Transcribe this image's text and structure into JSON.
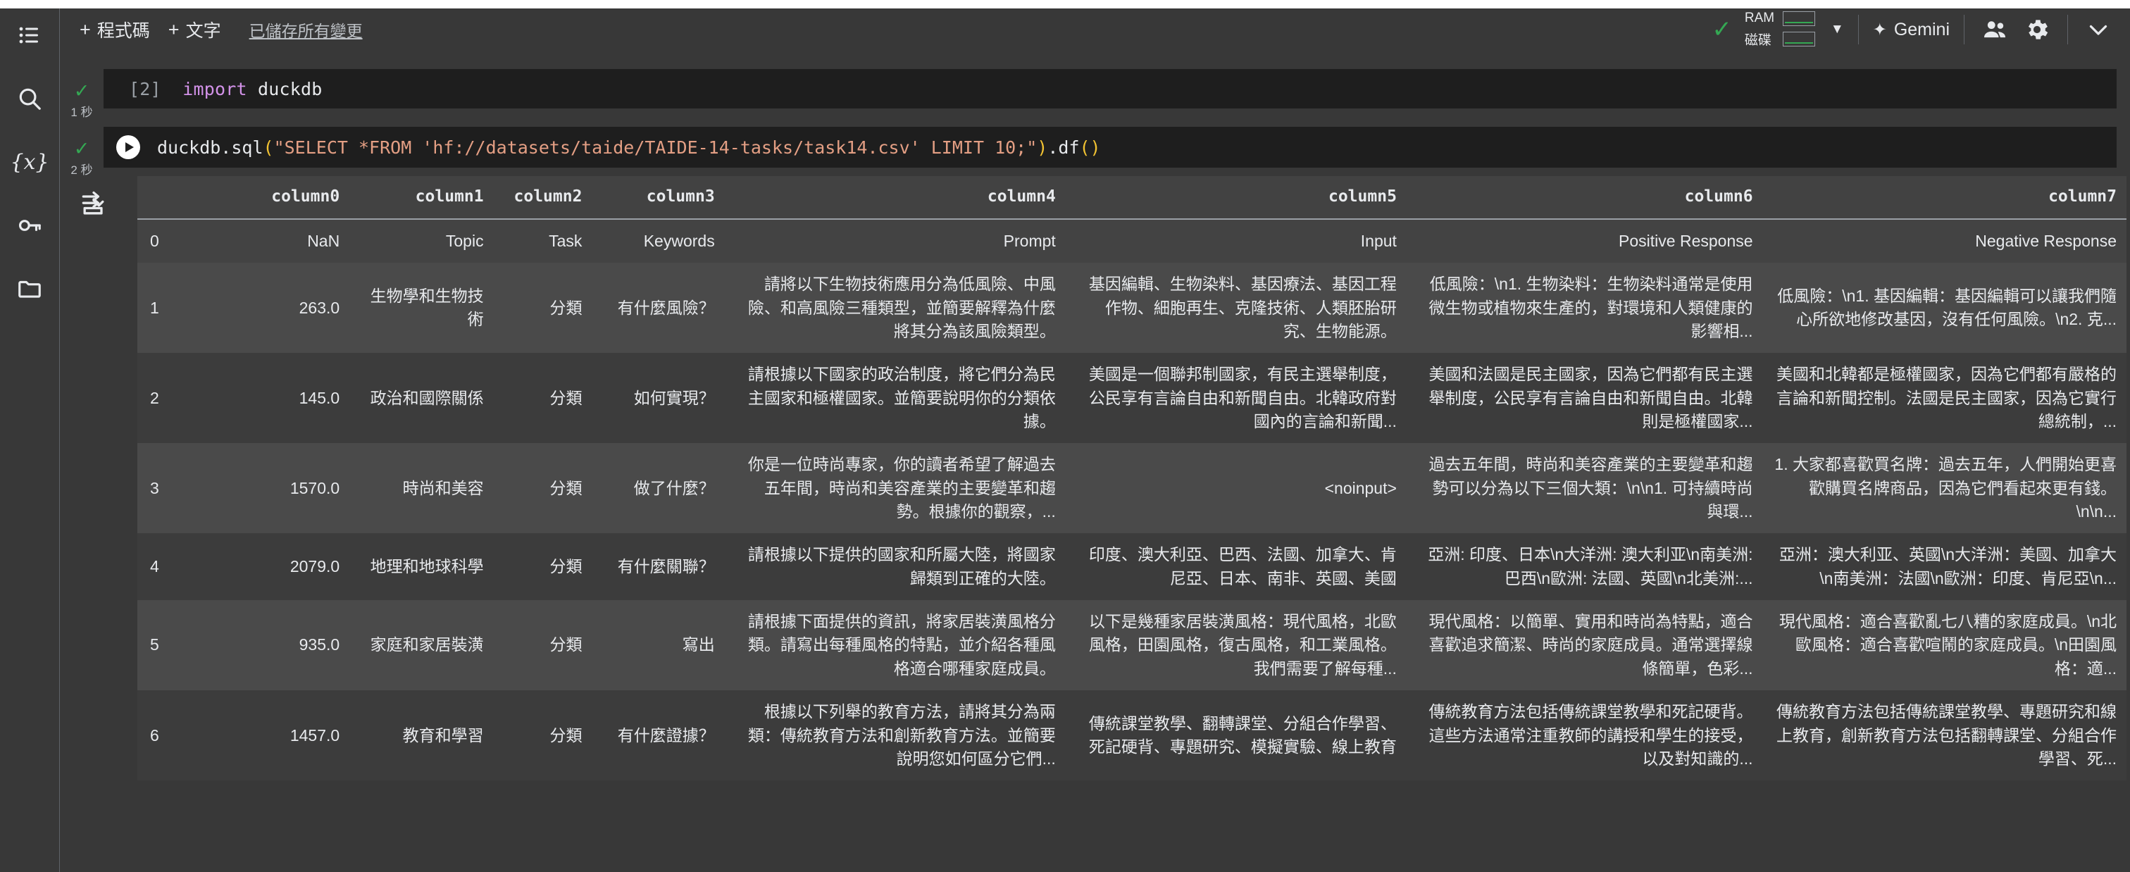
{
  "toolbar": {
    "add_code_label": "程式碼",
    "add_text_label": "文字",
    "plus": "+",
    "saved_label": "已儲存所有變更",
    "status_check": "✓",
    "ram_label": "RAM",
    "disk_label": "磁碟",
    "resources_caret": "▼",
    "gemini_label": "Gemini",
    "gemini_spark": "✦",
    "share_icon_name": "people-icon",
    "settings_icon_name": "gear-icon",
    "collapse_caret": "⌄"
  },
  "sidebar": {
    "items": [
      {
        "name": "table-of-contents-icon",
        "glyph": "toc"
      },
      {
        "name": "search-icon",
        "glyph": "search"
      },
      {
        "name": "variables-icon",
        "glyph": "{x}"
      },
      {
        "name": "secrets-key-icon",
        "glyph": "key"
      },
      {
        "name": "files-folder-icon",
        "glyph": "folder"
      }
    ]
  },
  "cells": [
    {
      "exec_count": "[2]",
      "status": "✓",
      "runtime": "1 秒",
      "code_tokens": [
        {
          "t": "[2]",
          "c": "brk"
        },
        {
          "t": "  ",
          "c": "plain"
        },
        {
          "t": "import",
          "c": "kw"
        },
        {
          "t": " duckdb",
          "c": "plain"
        }
      ]
    },
    {
      "status": "✓",
      "runtime": "2 秒",
      "code_tokens": [
        {
          "t": "duckdb.sql",
          "c": "plain"
        },
        {
          "t": "(",
          "c": "paren"
        },
        {
          "t": "\"SELECT *FROM 'hf://datasets/taide/TAIDE-14-tasks/task14.csv' LIMIT 10;\"",
          "c": "str"
        },
        {
          "t": ")",
          "c": "paren"
        },
        {
          "t": ".df",
          "c": "plain"
        },
        {
          "t": "()",
          "c": "paren"
        }
      ],
      "code_plain": "duckdb.sql(\"SELECT *FROM 'hf://datasets/taide/TAIDE-14-tasks/task14.csv' LIMIT 10;\").df()"
    }
  ],
  "output": {
    "toggle_icon_name": "output-format-icon",
    "table_view_icon_name": "table-view-icon",
    "chart_view_icon_name": "chart-view-icon",
    "columns": [
      "",
      "column0",
      "column1",
      "column2",
      "column3",
      "column4",
      "column5",
      "column6",
      "column7"
    ],
    "rows": [
      {
        "index": "0",
        "cells": [
          "NaN",
          "Topic",
          "Task",
          "Keywords",
          "Prompt",
          "Input",
          "Positive Response",
          "Negative Response"
        ]
      },
      {
        "index": "1",
        "cells": [
          "263.0",
          "生物學和生物技術",
          "分類",
          "有什麼風險？",
          "請將以下生物技術應用分為低風險、中風險、和高風險三種類型，並簡要解釋為什麼將其分為該風險類型。",
          "基因編輯、生物染料、基因療法、基因工程作物、細胞再生、克隆技術、人類胚胎研究、生物能源。",
          "低風險：\\n1. 生物染料：生物染料通常是使用微生物或植物來生產的，對環境和人類健康的影響相...",
          "低風險：\\n1. 基因編輯：基因編輯可以讓我們隨心所欲地修改基因，沒有任何風險。\\n2. 克..."
        ]
      },
      {
        "index": "2",
        "cells": [
          "145.0",
          "政治和國際關係",
          "分類",
          "如何實現？",
          "請根據以下國家的政治制度，將它們分為民主國家和極權國家。並簡要說明你的分類依據。",
          "美國是一個聯邦制國家，有民主選舉制度，公民享有言論自由和新聞自由。北韓政府對國內的言論和新聞...",
          "美國和法國是民主國家，因為它們都有民主選舉制度，公民享有言論自由和新聞自由。北韓則是極權國家...",
          "美國和北韓都是極權國家，因為它們都有嚴格的言論和新聞控制。法國是民主國家，因為它實行總統制，..."
        ]
      },
      {
        "index": "3",
        "cells": [
          "1570.0",
          "時尚和美容",
          "分類",
          "做了什麼？",
          "你是一位時尚專家，你的讀者希望了解過去五年間，時尚和美容產業的主要變革和趨勢。根據你的觀察，...",
          "<noinput>",
          "過去五年間，時尚和美容產業的主要變革和趨勢可以分為以下三個大類：\\n\\n1. 可持續時尚與環...",
          "1. 大家都喜歡買名牌：過去五年，人們開始更喜歡購買名牌商品，因為它們看起來更有錢。\\n\\n..."
        ]
      },
      {
        "index": "4",
        "cells": [
          "2079.0",
          "地理和地球科學",
          "分類",
          "有什麼關聯？",
          "請根據以下提供的國家和所屬大陸，將國家歸類到正確的大陸。",
          "印度、澳大利亞、巴西、法國、加拿大、肯尼亞、日本、南非、英國、美國",
          "亞洲: 印度、日本\\n大洋洲: 澳大利亚\\n南美洲: 巴西\\n歐洲: 法國、英國\\n北美洲:...",
          "亞洲：澳大利亚、英國\\n大洋洲：美國、加拿大\\n南美洲：法國\\n歐洲：印度、肯尼亞\\n..."
        ]
      },
      {
        "index": "5",
        "cells": [
          "935.0",
          "家庭和家居裝潢",
          "分類",
          "寫出",
          "請根據下面提供的資訊，將家居裝潢風格分類。請寫出每種風格的特點，並介紹各種風格適合哪種家庭成員。",
          "以下是幾種家居裝潢風格：現代風格，北歐風格，田園風格，復古風格，和工業風格。我們需要了解每種...",
          "現代風格：以簡單、實用和時尚為特點，適合喜歡追求簡潔、時尚的家庭成員。通常選擇線條簡單，色彩...",
          "現代風格：適合喜歡亂七八糟的家庭成員。\\n北歐風格：適合喜歡喧鬧的家庭成員。\\n田園風格：適..."
        ]
      },
      {
        "index": "6",
        "cells": [
          "1457.0",
          "教育和學習",
          "分類",
          "有什麼證據？",
          "根據以下列舉的教育方法，請將其分為兩類：傳統教育方法和創新教育方法。並簡要說明您如何區分它們...",
          "傳統課堂教學、翻轉課堂、分組合作學習、死記硬背、專題研究、模擬實驗、線上教育",
          "傳統教育方法包括傳統課堂教學和死記硬背。這些方法通常注重教師的講授和學生的接受，以及對知識的...",
          "傳統教育方法包括傳統課堂教學、專題研究和線上教育，創新教育方法包括翻轉課堂、分組合作學習、死..."
        ]
      }
    ]
  }
}
